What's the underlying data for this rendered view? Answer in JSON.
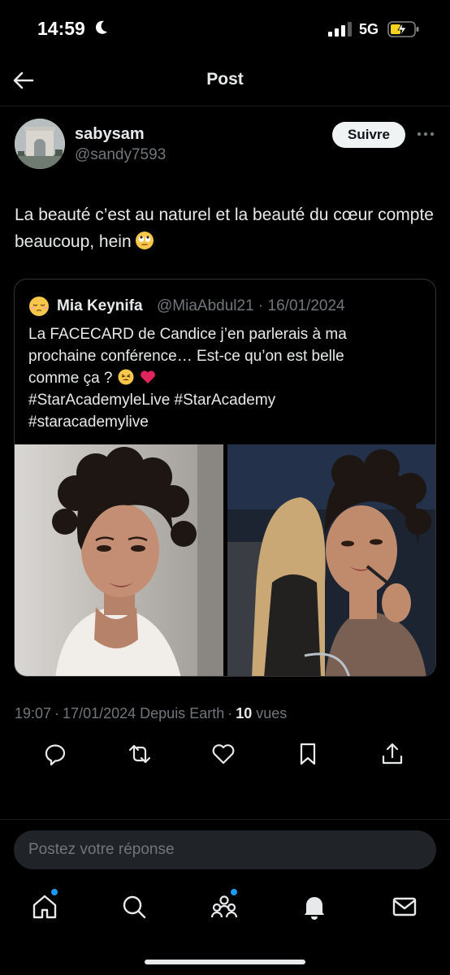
{
  "status_bar": {
    "time": "14:59",
    "network": "5G",
    "icons": [
      "moon-icon",
      "signal-icon",
      "battery-charging-icon"
    ]
  },
  "header": {
    "title": "Post",
    "back_icon": "arrow-left-icon"
  },
  "post": {
    "author_name": "sabysam",
    "author_handle": "@sandy7593",
    "follow_label": "Suivre",
    "text": "La beauté c’est au naturel et la beauté du cœur compte beaucoup, hein",
    "text_emoji": "face-with-rolling-eyes",
    "meta": {
      "time": "19:07",
      "date": "17/01/2024",
      "source": "Depuis Earth",
      "views_count": "10",
      "views_label": "vues"
    }
  },
  "quote": {
    "author_name": "Mia Keynifa",
    "author_handle": "@MiaAbdul21",
    "date": "16/01/2024",
    "text_line1": "La FACECARD de Candice j’en parlerais à ma",
    "text_line2": "prochaine conférence… Est-ce qu’on est belle",
    "text_line3": "comme ça ?",
    "hashtags_line1": "#StarAcademyleLive #StarAcademy",
    "hashtags_line2": "#staracademylive",
    "emojis": [
      "tired-face",
      "red-heart"
    ],
    "images": [
      "portrait-photo",
      "makeup-photo"
    ]
  },
  "actions": [
    "reply-icon",
    "repost-icon",
    "like-icon",
    "bookmark-icon",
    "share-icon"
  ],
  "reply": {
    "placeholder": "Postez votre réponse"
  },
  "bottom_nav": [
    "home-icon",
    "search-icon",
    "communities-icon",
    "notifications-icon",
    "messages-icon"
  ],
  "colors": {
    "background": "#000000",
    "text": "#e7e9ea",
    "secondary": "#71767b",
    "border": "#2f3336",
    "accent": "#1d9bf0",
    "heart": "#e0245e"
  }
}
